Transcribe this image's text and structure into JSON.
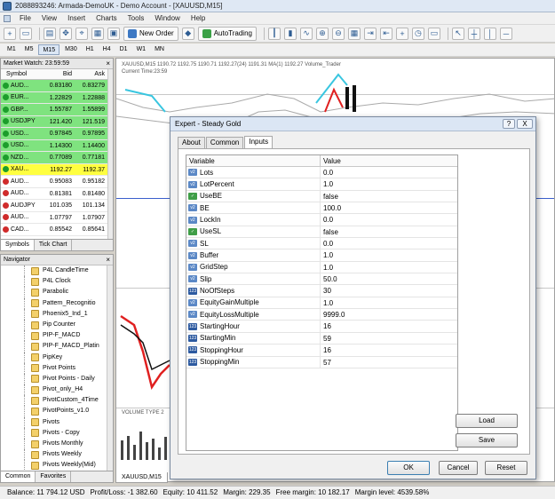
{
  "window": {
    "title": "2088893246: Armada-DemoUK - Demo Account - [XAUUSD,M15]"
  },
  "menu": [
    "File",
    "View",
    "Insert",
    "Charts",
    "Tools",
    "Window",
    "Help"
  ],
  "toolbar": {
    "new_order": "New Order",
    "auto_trading": "AutoTrading"
  },
  "periods": [
    "M1",
    "M5",
    "M15",
    "M30",
    "H1",
    "H4",
    "D1",
    "W1",
    "MN"
  ],
  "active_period": "M15",
  "market_watch": {
    "title": "Market Watch: 23:59:59",
    "columns": [
      "Symbol",
      "Bid",
      "Ask"
    ],
    "rows": [
      {
        "symbol": "AUD...",
        "bid": "0.83180",
        "ask": "0.83279",
        "bg": "#7fe37f"
      },
      {
        "symbol": "EUR...",
        "bid": "1.22829",
        "ask": "1.22888",
        "bg": "#7fe37f"
      },
      {
        "symbol": "GBP...",
        "bid": "1.55787",
        "ask": "1.55899",
        "bg": "#7fe37f"
      },
      {
        "symbol": "USDJPY",
        "bid": "121.420",
        "ask": "121.519",
        "bg": "#7fe37f"
      },
      {
        "symbol": "USD...",
        "bid": "0.97845",
        "ask": "0.97895",
        "bg": "#7fe37f"
      },
      {
        "symbol": "USD...",
        "bid": "1.14300",
        "ask": "1.14400",
        "bg": "#7fe37f"
      },
      {
        "symbol": "NZD...",
        "bid": "0.77089",
        "ask": "0.77181",
        "bg": "#7fe37f"
      },
      {
        "symbol": "XAU...",
        "bid": "1192.27",
        "ask": "1192.37",
        "bg": "#ffff40"
      },
      {
        "symbol": "AUD...",
        "bid": "0.95083",
        "ask": "0.95182",
        "bg": "#ffffff"
      },
      {
        "symbol": "AUD...",
        "bid": "0.81381",
        "ask": "0.81480",
        "bg": "#ffffff"
      },
      {
        "symbol": "AUDJPY",
        "bid": "101.035",
        "ask": "101.134",
        "bg": "#ffffff"
      },
      {
        "symbol": "AUD...",
        "bid": "1.07797",
        "ask": "1.07907",
        "bg": "#ffffff"
      },
      {
        "symbol": "CAD...",
        "bid": "0.85542",
        "ask": "0.85641",
        "bg": "#ffffff"
      }
    ],
    "tabs": [
      "Symbols",
      "Tick Chart"
    ]
  },
  "navigator": {
    "title": "Navigator",
    "items": [
      "P4L CandleTime",
      "P4L Clock",
      "Parabolic",
      "Pattern_Recognitio",
      "Phoenix5_Ind_1",
      "Pip Counter",
      "PIP-F_MACD",
      "PIP-F_MACD_Platin",
      "PipKey",
      "Pivot Points",
      "Pivot Points - Daily",
      "Pivot_only_H4",
      "PivotCustom_4Time",
      "PivotPoints_v1.0",
      "Pivots",
      "Pivots - Copy",
      "Pivots Monthly",
      "Pivots Weekly",
      "Pivots Weekly(Mid)"
    ],
    "tabs": [
      "Common",
      "Favorites"
    ]
  },
  "chart": {
    "header": "XAUUSD,M15  1190.72 1192.75 1190.71 1192.27(24) 1191.31  MA(1) 1192.27  Volume_Trader",
    "subheader": "Current Time:23:59",
    "tab": "XAUUSD,M15",
    "bottom_label": "VOLUME TYPE 2"
  },
  "dialog": {
    "title": "Expert - Steady Gold",
    "help": "?",
    "close": "X",
    "tabs": [
      "About",
      "Common",
      "Inputs"
    ],
    "active_tab": "Inputs",
    "columns": [
      "Variable",
      "Value"
    ],
    "inputs": [
      {
        "type": "dbl",
        "name": "Lots",
        "value": "0.0"
      },
      {
        "type": "dbl",
        "name": "LotPercent",
        "value": "1.0"
      },
      {
        "type": "bool",
        "name": "UseBE",
        "value": "false"
      },
      {
        "type": "dbl",
        "name": "BE",
        "value": "100.0"
      },
      {
        "type": "dbl",
        "name": "LockIn",
        "value": "0.0"
      },
      {
        "type": "bool",
        "name": "UseSL",
        "value": "false"
      },
      {
        "type": "dbl",
        "name": "SL",
        "value": "0.0"
      },
      {
        "type": "dbl",
        "name": "Buffer",
        "value": "1.0"
      },
      {
        "type": "dbl",
        "name": "GridStep",
        "value": "1.0"
      },
      {
        "type": "dbl",
        "name": "Slip",
        "value": "50.0"
      },
      {
        "type": "int",
        "name": "NoOfSteps",
        "value": "30"
      },
      {
        "type": "dbl",
        "name": "EquityGainMultiple",
        "value": "1.0"
      },
      {
        "type": "dbl",
        "name": "EquityLossMultiple",
        "value": "9999.0"
      },
      {
        "type": "int",
        "name": "StartingHour",
        "value": "16"
      },
      {
        "type": "int",
        "name": "StartingMin",
        "value": "59"
      },
      {
        "type": "int",
        "name": "StoppingHour",
        "value": "16"
      },
      {
        "type": "int",
        "name": "StoppingMin",
        "value": "57"
      }
    ],
    "load": "Load",
    "save": "Save",
    "ok": "OK",
    "cancel": "Cancel",
    "reset": "Reset"
  },
  "status": {
    "balance": "Balance: 11 794.12 USD",
    "profit": "Profit/Loss: -1 382.60",
    "equity": "Equity: 10 411.52",
    "margin": "Margin: 229.35",
    "free_margin": "Free margin: 10 182.17",
    "margin_level": "Margin level: 4539.58%"
  }
}
